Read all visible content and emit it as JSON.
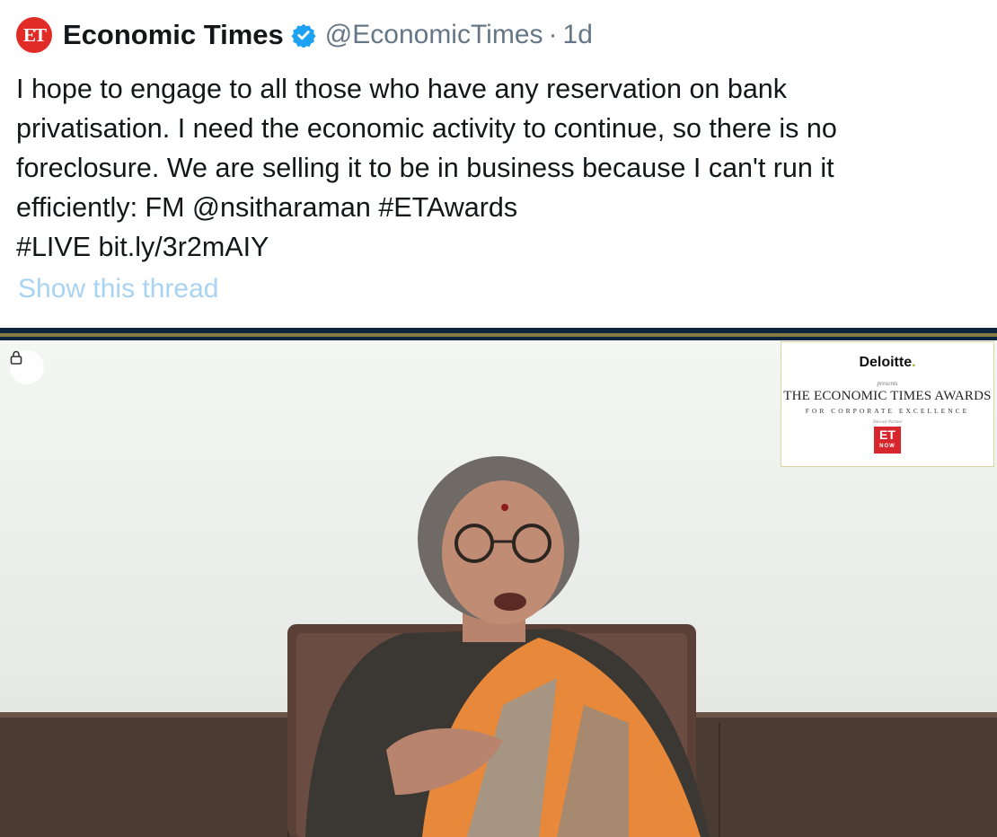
{
  "tweet": {
    "logo_text": "ET",
    "display_name": "Economic Times",
    "handle": "@EconomicTimes",
    "separator": "·",
    "timestamp": "1d",
    "text_lines": [
      "I hope to engage to all those who have any reservation on bank",
      "privatisation. I need the economic activity to continue, so there is no",
      "foreclosure. We are selling it to be in business because I can't run it",
      "efficiently: FM @nsitharaman #ETAwards",
      "#LIVE  bit.ly/3r2mAIY"
    ],
    "show_thread": "Show this thread",
    "icons": {
      "verified": "verified-badge-icon",
      "lock": "lock-icon"
    },
    "colors": {
      "verified": "#1da1f2",
      "brand": "#e02b26",
      "show_thread": "#a9d3f2"
    }
  },
  "video_overlay": {
    "sponsor": "Deloitte",
    "presents": "presents",
    "award_title": "THE ECONOMIC TIMES AWARDS",
    "award_subtitle": "FOR CORPORATE EXCELLENCE",
    "partner_label": "Telecast Partner",
    "channel_logo_main": "ET",
    "channel_logo_sub": "NOW"
  }
}
